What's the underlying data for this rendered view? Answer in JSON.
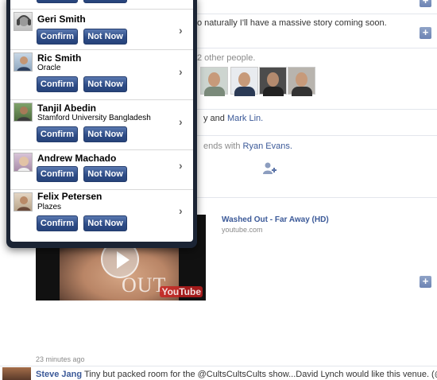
{
  "feed": {
    "story1_text": "o naturally I'll have a massive story coming soon.",
    "story2_text": "2 other people.",
    "story3_prefix": "y and",
    "story3_link": "Mark Lin.",
    "story4_prefix": "ends with",
    "story4_link": "Ryan Evans.",
    "video_title": "Washed Out - Far Away (HD)",
    "video_domain": "youtube.com",
    "video_brand": "OUT",
    "video_logo": "YouTube",
    "timestamp": "23 minutes ago",
    "bottom_author": "Steve Jang",
    "bottom_text": "Tiny but packed room for the @CultsCultsCults show...David Lynch would like this venue. (@",
    "plus_label": "+"
  },
  "requests": [
    {
      "name": "Geri Smith",
      "subtitle": "",
      "confirm": "Confirm",
      "not_now": "Not Now"
    },
    {
      "name": "Ric Smith",
      "subtitle": "Oracle",
      "confirm": "Confirm",
      "not_now": "Not Now"
    },
    {
      "name": "Tanjil Abedin",
      "subtitle": "Stamford University Bangladesh",
      "confirm": "Confirm",
      "not_now": "Not Now"
    },
    {
      "name": "Andrew Machado",
      "subtitle": "",
      "confirm": "Confirm",
      "not_now": "Not Now"
    },
    {
      "name": "Felix Petersen",
      "subtitle": "Plazes",
      "confirm": "Confirm",
      "not_now": "Not Now"
    }
  ],
  "colors": {
    "link": "#3b5998",
    "button": "#2f4d87",
    "popover_frame": "#1b2434"
  },
  "icons": {
    "chevron": "›",
    "add_friend": "person-plus-icon",
    "play": "play-icon"
  }
}
